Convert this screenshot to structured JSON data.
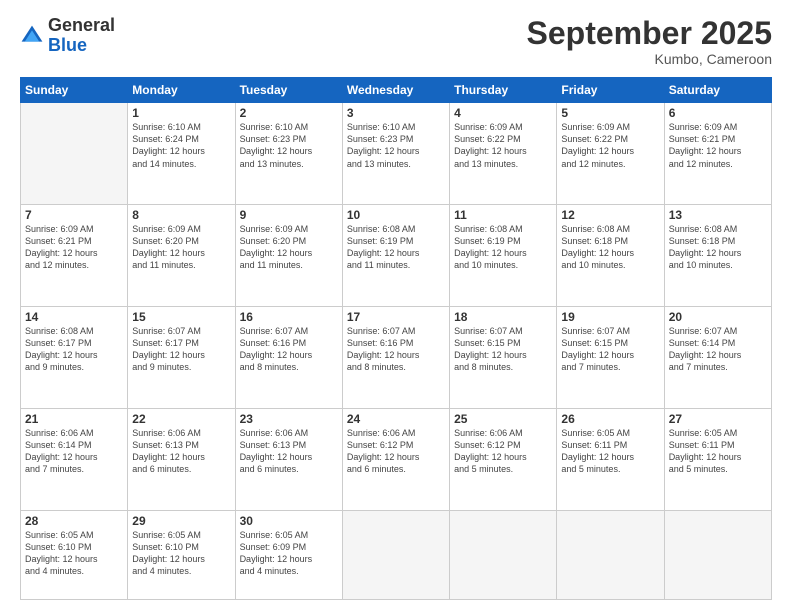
{
  "logo": {
    "general": "General",
    "blue": "Blue"
  },
  "title": "September 2025",
  "location": "Kumbo, Cameroon",
  "days_of_week": [
    "Sunday",
    "Monday",
    "Tuesday",
    "Wednesday",
    "Thursday",
    "Friday",
    "Saturday"
  ],
  "weeks": [
    [
      {
        "day": "",
        "info": ""
      },
      {
        "day": "1",
        "info": "Sunrise: 6:10 AM\nSunset: 6:24 PM\nDaylight: 12 hours\nand 14 minutes."
      },
      {
        "day": "2",
        "info": "Sunrise: 6:10 AM\nSunset: 6:23 PM\nDaylight: 12 hours\nand 13 minutes."
      },
      {
        "day": "3",
        "info": "Sunrise: 6:10 AM\nSunset: 6:23 PM\nDaylight: 12 hours\nand 13 minutes."
      },
      {
        "day": "4",
        "info": "Sunrise: 6:09 AM\nSunset: 6:22 PM\nDaylight: 12 hours\nand 13 minutes."
      },
      {
        "day": "5",
        "info": "Sunrise: 6:09 AM\nSunset: 6:22 PM\nDaylight: 12 hours\nand 12 minutes."
      },
      {
        "day": "6",
        "info": "Sunrise: 6:09 AM\nSunset: 6:21 PM\nDaylight: 12 hours\nand 12 minutes."
      }
    ],
    [
      {
        "day": "7",
        "info": "Sunrise: 6:09 AM\nSunset: 6:21 PM\nDaylight: 12 hours\nand 12 minutes."
      },
      {
        "day": "8",
        "info": "Sunrise: 6:09 AM\nSunset: 6:20 PM\nDaylight: 12 hours\nand 11 minutes."
      },
      {
        "day": "9",
        "info": "Sunrise: 6:09 AM\nSunset: 6:20 PM\nDaylight: 12 hours\nand 11 minutes."
      },
      {
        "day": "10",
        "info": "Sunrise: 6:08 AM\nSunset: 6:19 PM\nDaylight: 12 hours\nand 11 minutes."
      },
      {
        "day": "11",
        "info": "Sunrise: 6:08 AM\nSunset: 6:19 PM\nDaylight: 12 hours\nand 10 minutes."
      },
      {
        "day": "12",
        "info": "Sunrise: 6:08 AM\nSunset: 6:18 PM\nDaylight: 12 hours\nand 10 minutes."
      },
      {
        "day": "13",
        "info": "Sunrise: 6:08 AM\nSunset: 6:18 PM\nDaylight: 12 hours\nand 10 minutes."
      }
    ],
    [
      {
        "day": "14",
        "info": "Sunrise: 6:08 AM\nSunset: 6:17 PM\nDaylight: 12 hours\nand 9 minutes."
      },
      {
        "day": "15",
        "info": "Sunrise: 6:07 AM\nSunset: 6:17 PM\nDaylight: 12 hours\nand 9 minutes."
      },
      {
        "day": "16",
        "info": "Sunrise: 6:07 AM\nSunset: 6:16 PM\nDaylight: 12 hours\nand 8 minutes."
      },
      {
        "day": "17",
        "info": "Sunrise: 6:07 AM\nSunset: 6:16 PM\nDaylight: 12 hours\nand 8 minutes."
      },
      {
        "day": "18",
        "info": "Sunrise: 6:07 AM\nSunset: 6:15 PM\nDaylight: 12 hours\nand 8 minutes."
      },
      {
        "day": "19",
        "info": "Sunrise: 6:07 AM\nSunset: 6:15 PM\nDaylight: 12 hours\nand 7 minutes."
      },
      {
        "day": "20",
        "info": "Sunrise: 6:07 AM\nSunset: 6:14 PM\nDaylight: 12 hours\nand 7 minutes."
      }
    ],
    [
      {
        "day": "21",
        "info": "Sunrise: 6:06 AM\nSunset: 6:14 PM\nDaylight: 12 hours\nand 7 minutes."
      },
      {
        "day": "22",
        "info": "Sunrise: 6:06 AM\nSunset: 6:13 PM\nDaylight: 12 hours\nand 6 minutes."
      },
      {
        "day": "23",
        "info": "Sunrise: 6:06 AM\nSunset: 6:13 PM\nDaylight: 12 hours\nand 6 minutes."
      },
      {
        "day": "24",
        "info": "Sunrise: 6:06 AM\nSunset: 6:12 PM\nDaylight: 12 hours\nand 6 minutes."
      },
      {
        "day": "25",
        "info": "Sunrise: 6:06 AM\nSunset: 6:12 PM\nDaylight: 12 hours\nand 5 minutes."
      },
      {
        "day": "26",
        "info": "Sunrise: 6:05 AM\nSunset: 6:11 PM\nDaylight: 12 hours\nand 5 minutes."
      },
      {
        "day": "27",
        "info": "Sunrise: 6:05 AM\nSunset: 6:11 PM\nDaylight: 12 hours\nand 5 minutes."
      }
    ],
    [
      {
        "day": "28",
        "info": "Sunrise: 6:05 AM\nSunset: 6:10 PM\nDaylight: 12 hours\nand 4 minutes."
      },
      {
        "day": "29",
        "info": "Sunrise: 6:05 AM\nSunset: 6:10 PM\nDaylight: 12 hours\nand 4 minutes."
      },
      {
        "day": "30",
        "info": "Sunrise: 6:05 AM\nSunset: 6:09 PM\nDaylight: 12 hours\nand 4 minutes."
      },
      {
        "day": "",
        "info": ""
      },
      {
        "day": "",
        "info": ""
      },
      {
        "day": "",
        "info": ""
      },
      {
        "day": "",
        "info": ""
      }
    ]
  ]
}
